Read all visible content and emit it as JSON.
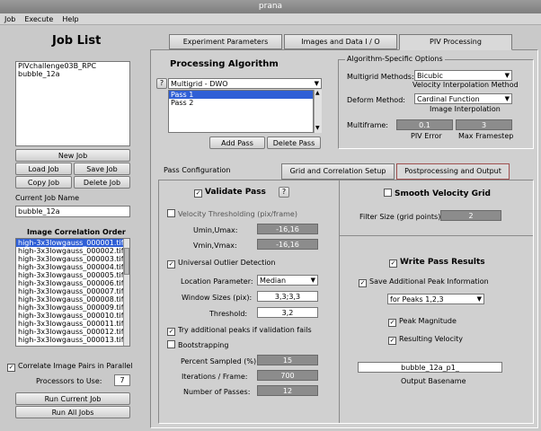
{
  "window": {
    "title": "prana"
  },
  "menu": [
    "Job",
    "Execute",
    "Help"
  ],
  "joblist": {
    "title": "Job List",
    "jobs": [
      "PIVchallenge03B_RPC",
      "bubble_12a"
    ],
    "new_job": "New Job",
    "load_job": "Load Job",
    "save_job": "Save Job",
    "copy_job": "Copy Job",
    "delete_job": "Delete Job",
    "current_job_label": "Current Job Name",
    "current_job_value": "bubble_12a",
    "image_order_title": "Image Correlation Order",
    "images": [
      "high-3x3lowgauss_000001.tif",
      "high-3x3lowgauss_000002.tif",
      "high-3x3lowgauss_000003.tif",
      "high-3x3lowgauss_000004.tif",
      "high-3x3lowgauss_000005.tif",
      "high-3x3lowgauss_000006.tif",
      "high-3x3lowgauss_000007.tif",
      "high-3x3lowgauss_000008.tif",
      "high-3x3lowgauss_000009.tif",
      "high-3x3lowgauss_000010.tif",
      "high-3x3lowgauss_000011.tif",
      "high-3x3lowgauss_000012.tif",
      "high-3x3lowgauss_000013.tif"
    ],
    "correlate_parallel": "Correlate Image Pairs in Parallel",
    "processors_label": "Processors to Use:",
    "processors_value": "7",
    "run_current": "Run Current Job",
    "run_all": "Run All Jobs"
  },
  "tabs": [
    "Experiment Parameters",
    "Images and Data I / O",
    "PIV Processing"
  ],
  "processing": {
    "title": "Processing Algorithm",
    "help": "?",
    "algorithm": "Multigrid - DWO",
    "passes": [
      "Pass 1",
      "Pass 2"
    ],
    "add_pass": "Add Pass",
    "delete_pass": "Delete Pass"
  },
  "algo_options": {
    "title": "Algorithm-Specific Options",
    "multigrid_label": "Multigrid Methods:",
    "multigrid_value": "Bicubic",
    "velocity_interp": "Velocity Interpolation Method",
    "deform_label": "Deform Method:",
    "deform_value": "Cardinal Function",
    "image_interp": "Image Interpolation",
    "multiframe_label": "Multiframe:",
    "piv_error_value": "0.1",
    "piv_error_label": "PIV Error",
    "max_framestep_value": "3",
    "max_framestep_label": "Max Framestep"
  },
  "pass_config": {
    "title": "Pass Configuration",
    "tab_grid": "Grid and Correlation Setup",
    "tab_post": "Postprocessing and Output"
  },
  "validation": {
    "validate_pass": "Validate Pass",
    "help": "?",
    "vel_thresh": "Velocity Thresholding (pix/frame)",
    "umin_label": "Umin,Umax:",
    "umin_value": "-16,16",
    "vmin_label": "Vmin,Vmax:",
    "vmin_value": "-16,16",
    "uod": "Universal Outlier Detection",
    "loc_param_label": "Location Parameter:",
    "loc_param_value": "Median",
    "window_label": "Window Sizes (pix):",
    "window_value": "3,3;3,3",
    "threshold_label": "Threshold:",
    "threshold_value": "3,2",
    "try_peaks": "Try additional peaks if validation fails",
    "bootstrapping": "Bootstrapping",
    "percent_label": "Percent Sampled (%):",
    "percent_value": "15",
    "iter_label": "Iterations / Frame:",
    "iter_value": "700",
    "passes_label": "Number of Passes:",
    "passes_value": "12"
  },
  "smoothing": {
    "title": "Smooth Velocity Grid",
    "filter_label": "Filter Size (grid points):",
    "filter_value": "2"
  },
  "output": {
    "write_results": "Write Pass Results",
    "save_peak": "Save Additional Peak Information",
    "peaks_value": "for Peaks 1,2,3",
    "peak_mag": "Peak Magnitude",
    "resulting_vel": "Resulting Velocity",
    "basename_value": "bubble_12a_p1_",
    "basename_label": "Output Basename"
  }
}
